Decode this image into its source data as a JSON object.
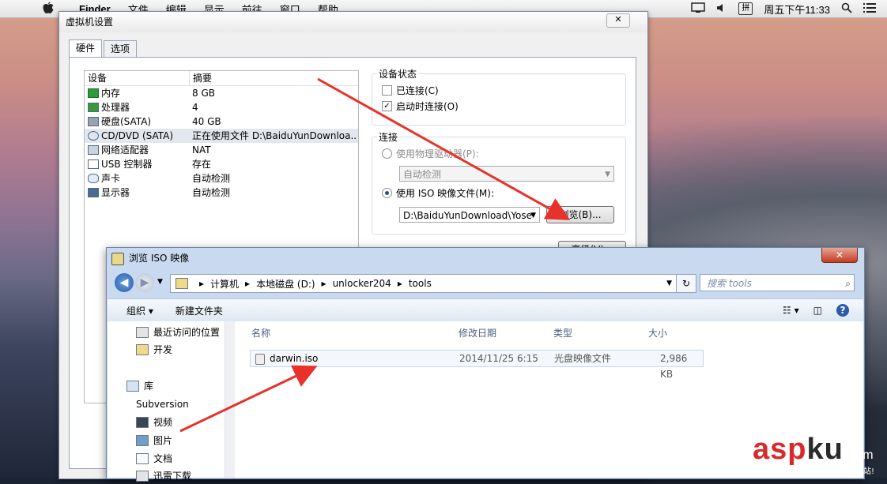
{
  "menubar": {
    "apple": "",
    "app": "Finder",
    "items": [
      "文件",
      "编辑",
      "显示",
      "前往",
      "窗口",
      "帮助"
    ],
    "clock": "周五下午11:33",
    "input_method": "拼"
  },
  "vm": {
    "title": "虚拟机设置",
    "close": "✕",
    "tabs": [
      "硬件",
      "选项"
    ],
    "columns": [
      "设备",
      "摘要"
    ],
    "devices": [
      {
        "name": "内存",
        "summary": "8 GB",
        "icon": "memory-icon"
      },
      {
        "name": "处理器",
        "summary": "4",
        "icon": "cpu-icon"
      },
      {
        "name": "硬盘(SATA)",
        "summary": "40 GB",
        "icon": "hdd-icon"
      },
      {
        "name": "CD/DVD (SATA)",
        "summary": "正在使用文件 D:\\BaiduYunDownloa...",
        "icon": "cdrom-icon"
      },
      {
        "name": "网络适配器",
        "summary": "NAT",
        "icon": "network-icon"
      },
      {
        "name": "USB 控制器",
        "summary": "存在",
        "icon": "usb-icon"
      },
      {
        "name": "声卡",
        "summary": "自动检测",
        "icon": "sound-icon"
      },
      {
        "name": "显示器",
        "summary": "自动检测",
        "icon": "display-icon"
      }
    ],
    "device_status": {
      "title": "设备状态",
      "connected": "已连接(C)",
      "connect_on_start": "启动时连接(O)"
    },
    "connection": {
      "title": "连接",
      "physical": "使用物理驱动器(P):",
      "physical_select": "自动检测",
      "iso": "使用 ISO 映像文件(M):",
      "iso_path": "D:\\BaiduYunDownload\\Yose",
      "browse": "浏览(B)...",
      "advanced": "高级(V)..."
    }
  },
  "dialog": {
    "title": "浏览 ISO 映像",
    "close": "✕",
    "breadcrumb": [
      "计算机",
      "本地磁盘 (D:)",
      "unlocker204",
      "tools"
    ],
    "search_placeholder": "搜索 tools",
    "toolbar": {
      "organize": "组织 ▾",
      "new_folder": "新建文件夹"
    },
    "nav": [
      {
        "label": "最近访问的位置",
        "indent": 1
      },
      {
        "label": "开发",
        "indent": 1
      },
      {
        "label": "库",
        "indent": 0
      },
      {
        "label": "Subversion",
        "indent": 1
      },
      {
        "label": "视频",
        "indent": 1
      },
      {
        "label": "图片",
        "indent": 1
      },
      {
        "label": "文档",
        "indent": 1
      },
      {
        "label": "迅雷下载",
        "indent": 1
      }
    ],
    "columns": {
      "name": "名称",
      "date": "修改日期",
      "type": "类型",
      "size": "大小"
    },
    "files": [
      {
        "name": "darwin.iso",
        "date": "2014/11/25 6:15",
        "type": "光盘映像文件",
        "size": "2,986 KB"
      }
    ]
  },
  "watermark": {
    "asp": "asp",
    "ku": "ku",
    "com": ".com",
    "sub": "免费网站源码下载站!"
  },
  "colors": {
    "arrow": "#e8312a",
    "accent": "#2a5ca8"
  }
}
